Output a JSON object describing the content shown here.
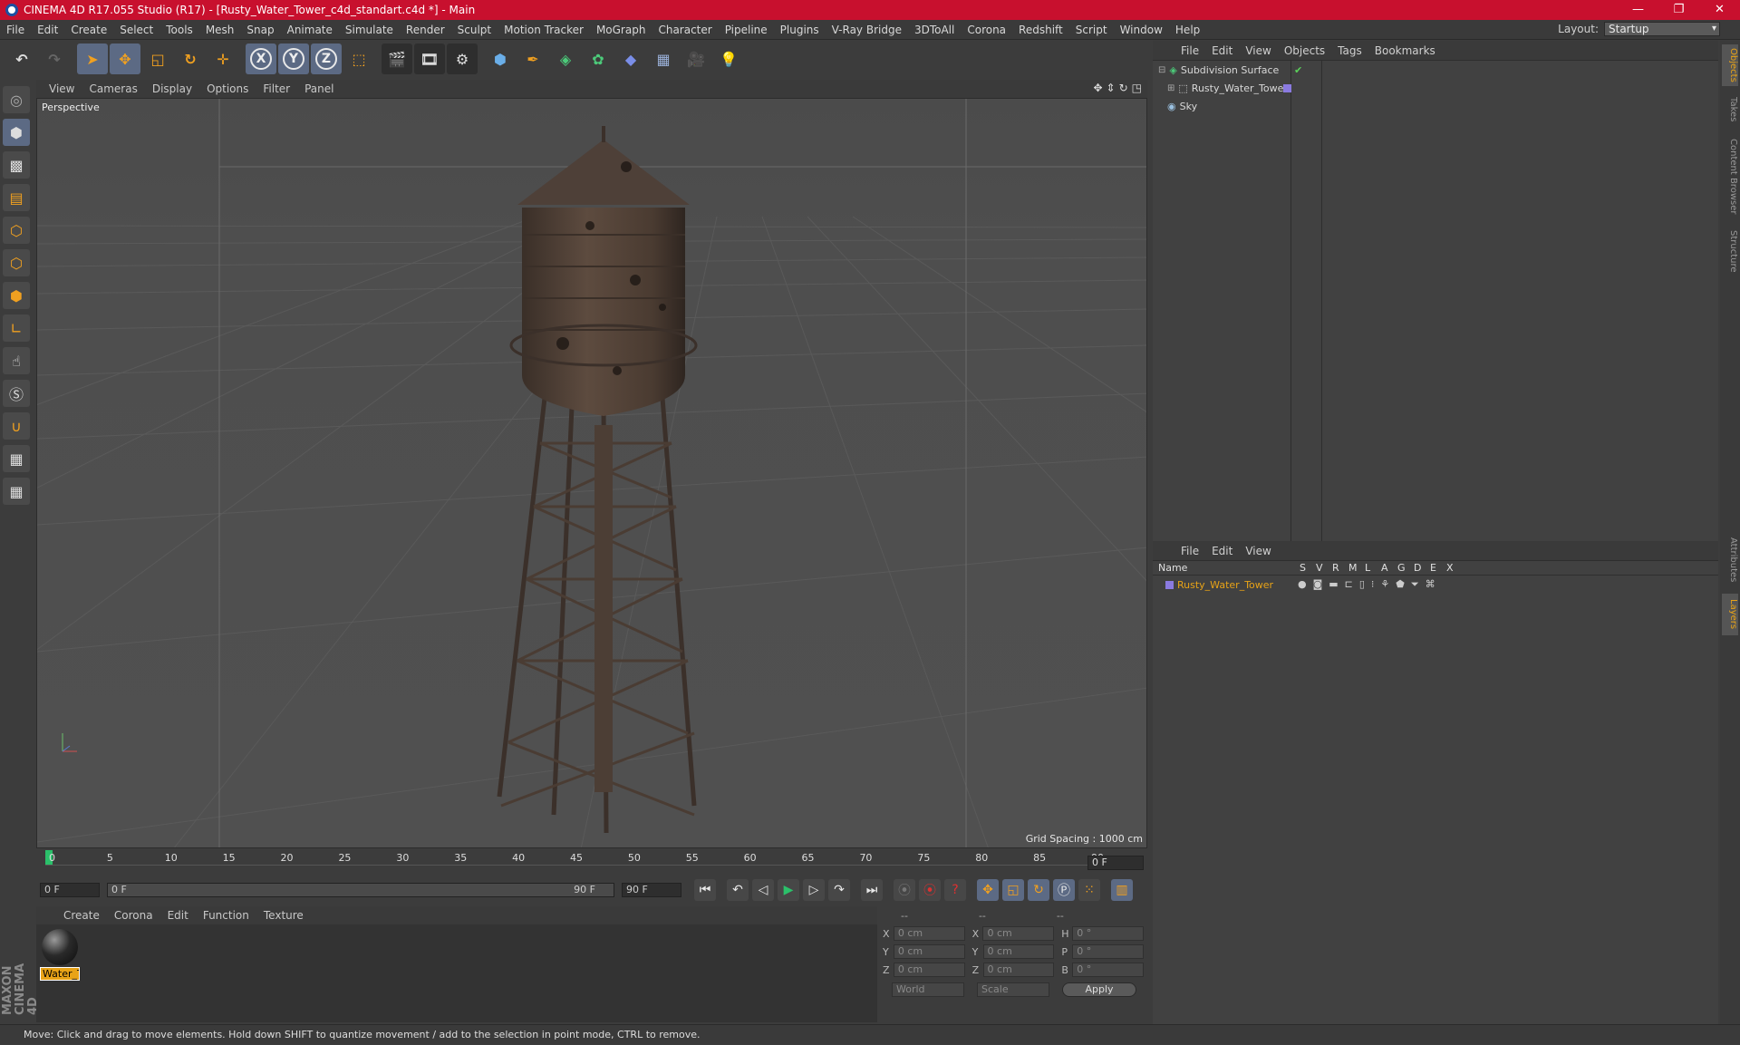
{
  "window": {
    "title": "CINEMA 4D R17.055 Studio (R17) - [Rusty_Water_Tower_c4d_standart.c4d *] - Main"
  },
  "menubar": [
    "File",
    "Edit",
    "Create",
    "Select",
    "Tools",
    "Mesh",
    "Snap",
    "Animate",
    "Simulate",
    "Render",
    "Sculpt",
    "Motion Tracker",
    "MoGraph",
    "Character",
    "Pipeline",
    "Plugins",
    "V-Ray Bridge",
    "3DToAll",
    "Corona",
    "Redshift",
    "Script",
    "Window",
    "Help"
  ],
  "layout": {
    "label": "Layout:",
    "value": "Startup"
  },
  "viewport": {
    "menu": [
      "View",
      "Cameras",
      "Display",
      "Options",
      "Filter",
      "Panel"
    ],
    "label": "Perspective",
    "grid_spacing": "Grid Spacing : 1000 cm"
  },
  "timeline": {
    "ticks": [
      "0",
      "5",
      "10",
      "15",
      "20",
      "25",
      "30",
      "35",
      "40",
      "45",
      "50",
      "55",
      "60",
      "65",
      "70",
      "75",
      "80",
      "85",
      "90"
    ],
    "current_frame": "0 F"
  },
  "transport": {
    "start": "0 F",
    "range_start": "0 F",
    "range_end": "90 F",
    "end": "90 F"
  },
  "material_manager": {
    "menu": [
      "Create",
      "Corona",
      "Edit",
      "Function",
      "Texture"
    ],
    "materials": [
      {
        "name": "Water_T"
      }
    ]
  },
  "coordinates": {
    "headers": [
      "--",
      "--",
      "--"
    ],
    "rows": [
      {
        "a": "X",
        "pos": "0 cm",
        "b": "X",
        "size": "0 cm",
        "c": "H",
        "rot": "0 °"
      },
      {
        "a": "Y",
        "pos": "0 cm",
        "b": "Y",
        "size": "0 cm",
        "c": "P",
        "rot": "0 °"
      },
      {
        "a": "Z",
        "pos": "0 cm",
        "b": "Z",
        "size": "0 cm",
        "c": "B",
        "rot": "0 °"
      }
    ],
    "mode": "World",
    "scale": "Scale",
    "apply": "Apply"
  },
  "object_manager": {
    "menu": [
      "File",
      "Edit",
      "View",
      "Objects",
      "Tags",
      "Bookmarks"
    ],
    "objects": [
      {
        "name": "Subdivision Surface"
      },
      {
        "name": "Rusty_Water_Tower"
      },
      {
        "name": "Sky"
      }
    ]
  },
  "layer_manager": {
    "menu": [
      "File",
      "Edit",
      "View"
    ],
    "columns": [
      "Name",
      "S",
      "V",
      "R",
      "M",
      "L",
      "A",
      "G",
      "D",
      "E",
      "X"
    ],
    "layers": [
      {
        "name": "Rusty_Water_Tower"
      }
    ]
  },
  "side_tabs": [
    "Objects",
    "Takes",
    "Content Browser",
    "Structure",
    "Attributes",
    "Layers"
  ],
  "status": "Move: Click and drag to move elements. Hold down SHIFT to quantize movement / add to the selection in point mode, CTRL to remove.",
  "colors": {
    "titlebar": "#c8102e",
    "accent": "#e8a317",
    "selection": "#5c6a84"
  }
}
